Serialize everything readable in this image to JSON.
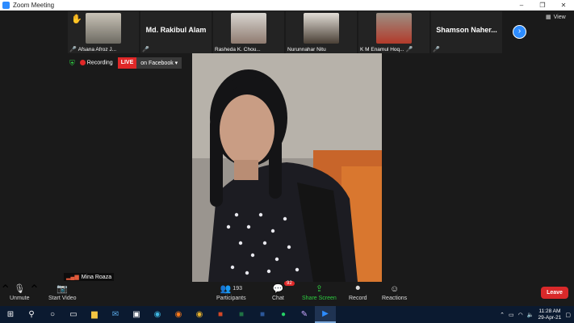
{
  "window": {
    "title": "Zoom Meeting",
    "minimize": "–",
    "maximize": "❐",
    "close": "✕"
  },
  "view_label": "View",
  "participants_strip": [
    {
      "name": "Afsana Afroz J...",
      "video": true,
      "hand_raised": true,
      "muted": true,
      "bg": "#6d6a62"
    },
    {
      "name": "Md. Rakibul Alam",
      "video": false,
      "muted": true
    },
    {
      "name": "Rasheda K. Chou...",
      "video": true,
      "muted": false,
      "bg": "#b9b6b0"
    },
    {
      "name": "Nurunnahar Nitu",
      "video": true,
      "muted": false,
      "bg": "#4a4036"
    },
    {
      "name": "K M Enamul Hoq...",
      "video": true,
      "muted": true,
      "bg": "#b23a2a"
    },
    {
      "name": "Shamson Naher...",
      "video": false,
      "muted": true
    }
  ],
  "status": {
    "recording": "Recording",
    "live": "LIVE",
    "stream_target": "on Facebook ▾"
  },
  "active_speaker": {
    "name": "Mina Roaza"
  },
  "toolbar": {
    "unmute": "Unmute",
    "start_video": "Start Video",
    "participants": "Participants",
    "participants_count": "193",
    "chat": "Chat",
    "chat_badge": "92",
    "share_screen": "Share Screen",
    "record": "Record",
    "reactions": "Reactions",
    "leave": "Leave"
  },
  "taskbar": {
    "time": "11:28 AM",
    "date": "29-Apr-21",
    "apps": [
      "windows-start",
      "search",
      "cortana",
      "task-view",
      "file-explorer",
      "mail",
      "terminal",
      "edge",
      "firefox",
      "chrome",
      "powerpoint",
      "excel",
      "word",
      "whatsapp",
      "paint",
      "zoom"
    ]
  },
  "colors": {
    "accent": "#2d8cff",
    "leave": "#d9292a",
    "live": "#e02828",
    "share": "#2ecc40"
  }
}
